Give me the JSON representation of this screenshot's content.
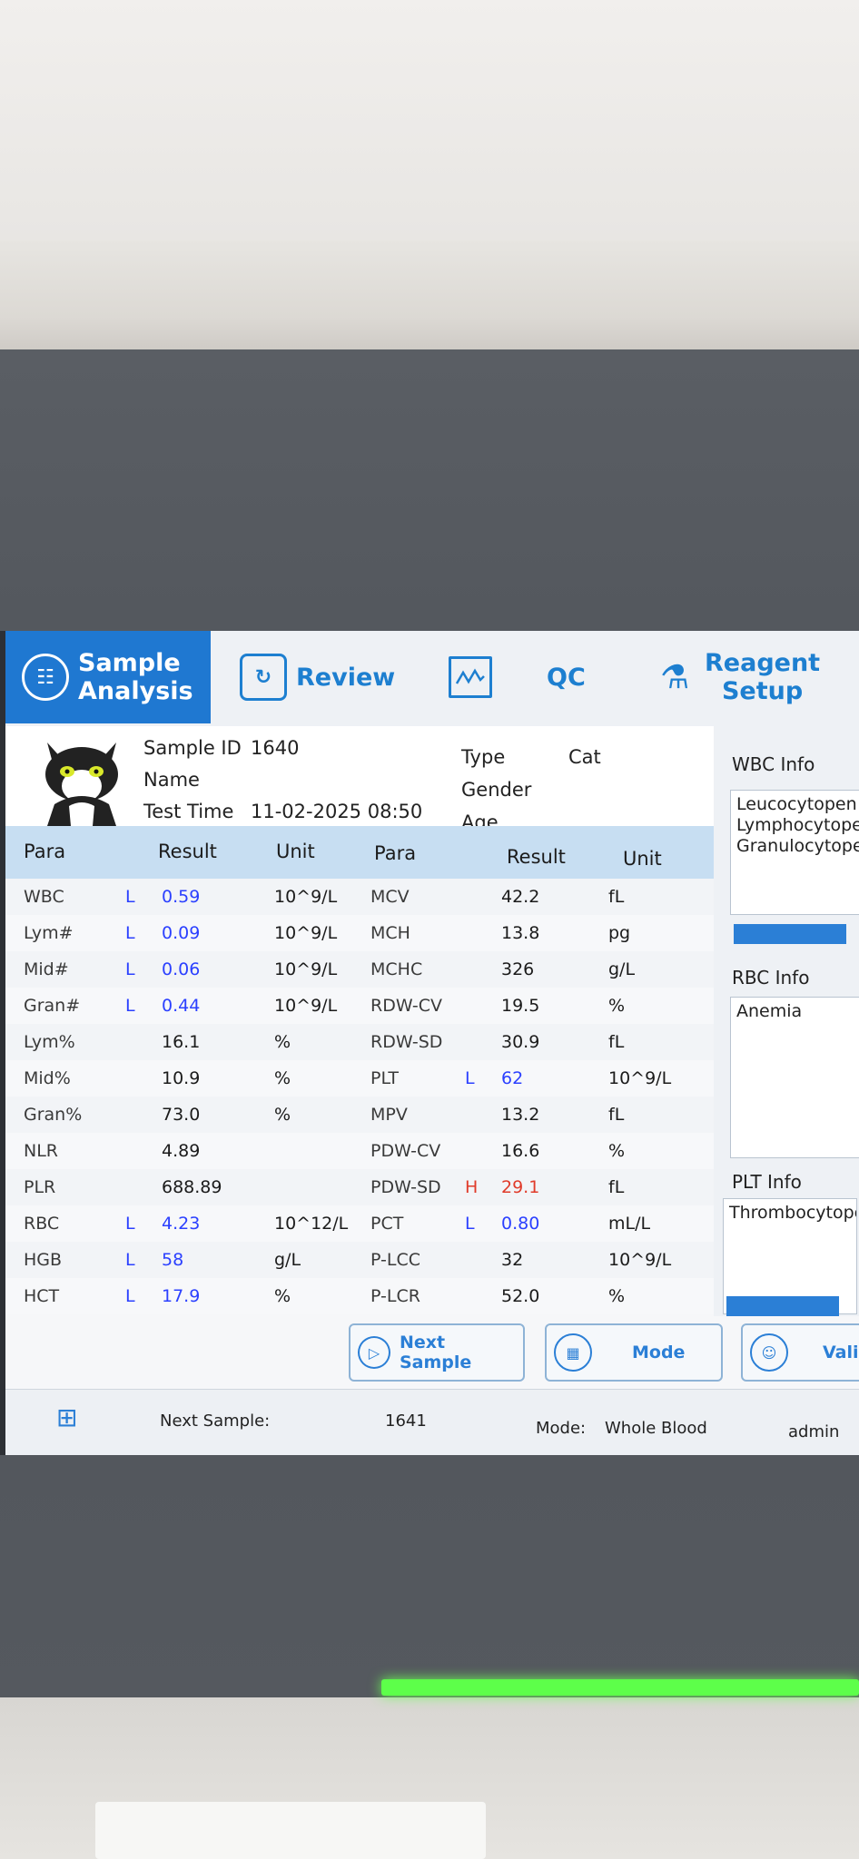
{
  "nav": {
    "tabs": [
      {
        "label_line1": "Sample",
        "label_line2": "Analysis",
        "icon": "tube-icon",
        "active": true
      },
      {
        "label": "Review",
        "icon": "review-icon"
      },
      {
        "label": "QC",
        "icon": "qc-chart-icon"
      },
      {
        "label_line1": "Reagent",
        "label_line2": "Setup",
        "icon": "flask-icon"
      }
    ]
  },
  "header": {
    "sample_id_label": "Sample ID",
    "sample_id": "1640",
    "name_label": "Name",
    "test_time_label": "Test Time",
    "test_time": "11-02-2025 08:50",
    "type_label": "Type",
    "type": "Cat",
    "gender_label": "Gender",
    "age_label": "Age"
  },
  "table": {
    "headers": {
      "para": "Para",
      "result": "Result",
      "unit": "Unit"
    },
    "left": [
      {
        "para": "WBC",
        "flag": "L",
        "result": "0.59",
        "unit": "10^9/L"
      },
      {
        "para": "Lym#",
        "flag": "L",
        "result": "0.09",
        "unit": "10^9/L"
      },
      {
        "para": "Mid#",
        "flag": "L",
        "result": "0.06",
        "unit": "10^9/L"
      },
      {
        "para": "Gran#",
        "flag": "L",
        "result": "0.44",
        "unit": "10^9/L"
      },
      {
        "para": "Lym%",
        "flag": "",
        "result": "16.1",
        "unit": "%"
      },
      {
        "para": "Mid%",
        "flag": "",
        "result": "10.9",
        "unit": "%"
      },
      {
        "para": "Gran%",
        "flag": "",
        "result": "73.0",
        "unit": "%"
      },
      {
        "para": "NLR",
        "flag": "",
        "result": "4.89",
        "unit": ""
      },
      {
        "para": "PLR",
        "flag": "",
        "result": "688.89",
        "unit": ""
      },
      {
        "para": "RBC",
        "flag": "L",
        "result": "4.23",
        "unit": "10^12/L"
      },
      {
        "para": "HGB",
        "flag": "L",
        "result": "58",
        "unit": "g/L"
      },
      {
        "para": "HCT",
        "flag": "L",
        "result": "17.9",
        "unit": "%"
      }
    ],
    "right": [
      {
        "para": "MCV",
        "flag": "",
        "result": "42.2",
        "unit": "fL"
      },
      {
        "para": "MCH",
        "flag": "",
        "result": "13.8",
        "unit": "pg"
      },
      {
        "para": "MCHC",
        "flag": "",
        "result": "326",
        "unit": "g/L"
      },
      {
        "para": "RDW-CV",
        "flag": "",
        "result": "19.5",
        "unit": "%"
      },
      {
        "para": "RDW-SD",
        "flag": "",
        "result": "30.9",
        "unit": "fL"
      },
      {
        "para": "PLT",
        "flag": "L",
        "result": "62",
        "unit": "10^9/L"
      },
      {
        "para": "MPV",
        "flag": "",
        "result": "13.2",
        "unit": "fL"
      },
      {
        "para": "PDW-CV",
        "flag": "",
        "result": "16.6",
        "unit": "%"
      },
      {
        "para": "PDW-SD",
        "flag": "H",
        "result": "29.1",
        "unit": "fL"
      },
      {
        "para": "PCT",
        "flag": "L",
        "result": "0.80",
        "unit": "mL/L"
      },
      {
        "para": "P-LCC",
        "flag": "",
        "result": "32",
        "unit": "10^9/L"
      },
      {
        "para": "P-LCR",
        "flag": "",
        "result": "52.0",
        "unit": "%"
      }
    ]
  },
  "info_panel": {
    "wbc_title": "WBC Info",
    "wbc_lines": [
      "Leucocytopen",
      "Lymphocytope",
      "Granulocytope"
    ],
    "rbc_title": "RBC Info",
    "rbc_lines": [
      "Anemia"
    ],
    "plt_title": "PLT Info",
    "plt_lines": [
      "Thrombocytopen"
    ]
  },
  "actions": {
    "next_sample": "Next Sample",
    "mode": "Mode",
    "validate": "Valid"
  },
  "status": {
    "next_sample_label": "Next Sample:",
    "next_sample_id": "1641",
    "mode_label": "Mode:",
    "mode_value": "Whole Blood",
    "user": "admin"
  },
  "colors": {
    "accent": "#1f78d1",
    "low_flag": "#2b40ff",
    "high_flag": "#e03b2a",
    "header_row": "#c7def2"
  }
}
